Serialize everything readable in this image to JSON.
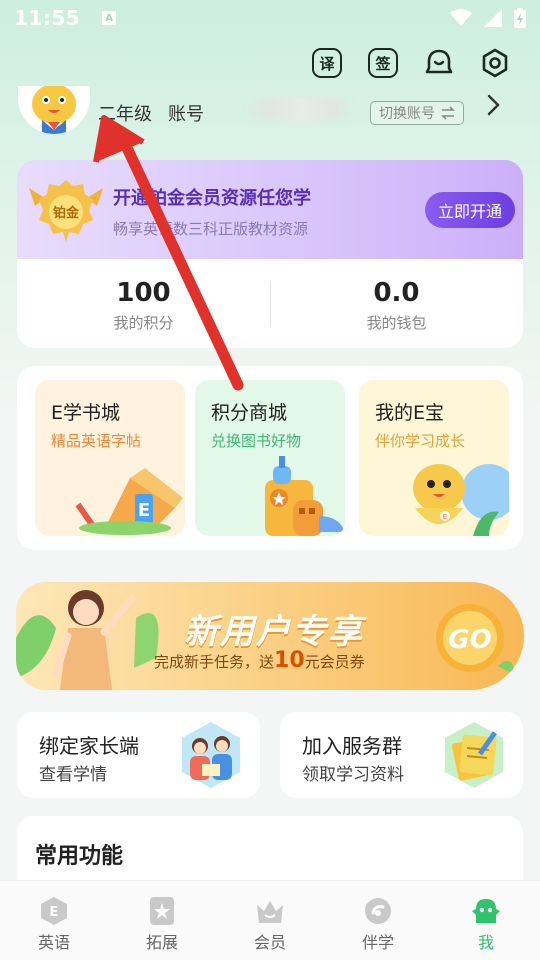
{
  "status_bar": {
    "time": "11:55",
    "notif_icon": "A"
  },
  "header": {
    "translate_icon": "译",
    "sign_icon": "签"
  },
  "profile": {
    "grade": "二年级",
    "account_label": "账号",
    "switch_label": "切换账号"
  },
  "membership": {
    "medal_text": "铂金",
    "title": "开通铂金会员资源任您学",
    "subtitle": "畅享英语数三科正版教材资源",
    "open_button": "立即开通",
    "points_value": "100",
    "points_label": "我的积分",
    "wallet_value": "0.0",
    "wallet_label": "我的钱包"
  },
  "store": {
    "tiles": [
      {
        "title": "E学书城",
        "subtitle": "精品英语字帖"
      },
      {
        "title": "积分商城",
        "subtitle": "兑换图书好物"
      },
      {
        "title": "我的E宝",
        "subtitle": "伴你学习成长"
      }
    ]
  },
  "promo": {
    "title": "新用户专享",
    "sub_prefix": "完成新手任务，送",
    "sub_amount": "10",
    "sub_suffix": "元会员券",
    "go_text": "GO"
  },
  "cards": [
    {
      "title": "绑定家长端",
      "subtitle": "查看学情"
    },
    {
      "title": "加入服务群",
      "subtitle": "领取学习资料"
    }
  ],
  "common": {
    "title": "常用功能"
  },
  "nav": [
    {
      "label": "英语",
      "icon": "english-icon"
    },
    {
      "label": "拓展",
      "icon": "star-book-icon"
    },
    {
      "label": "会员",
      "icon": "crown-icon"
    },
    {
      "label": "伴学",
      "icon": "companion-icon"
    },
    {
      "label": "我",
      "icon": "me-icon"
    }
  ],
  "colors": {
    "accent_green": "#2fc36e",
    "member_purple": "#6d3ee0",
    "promo_orange": "#f8b855",
    "arrow_red": "#e0322b"
  }
}
